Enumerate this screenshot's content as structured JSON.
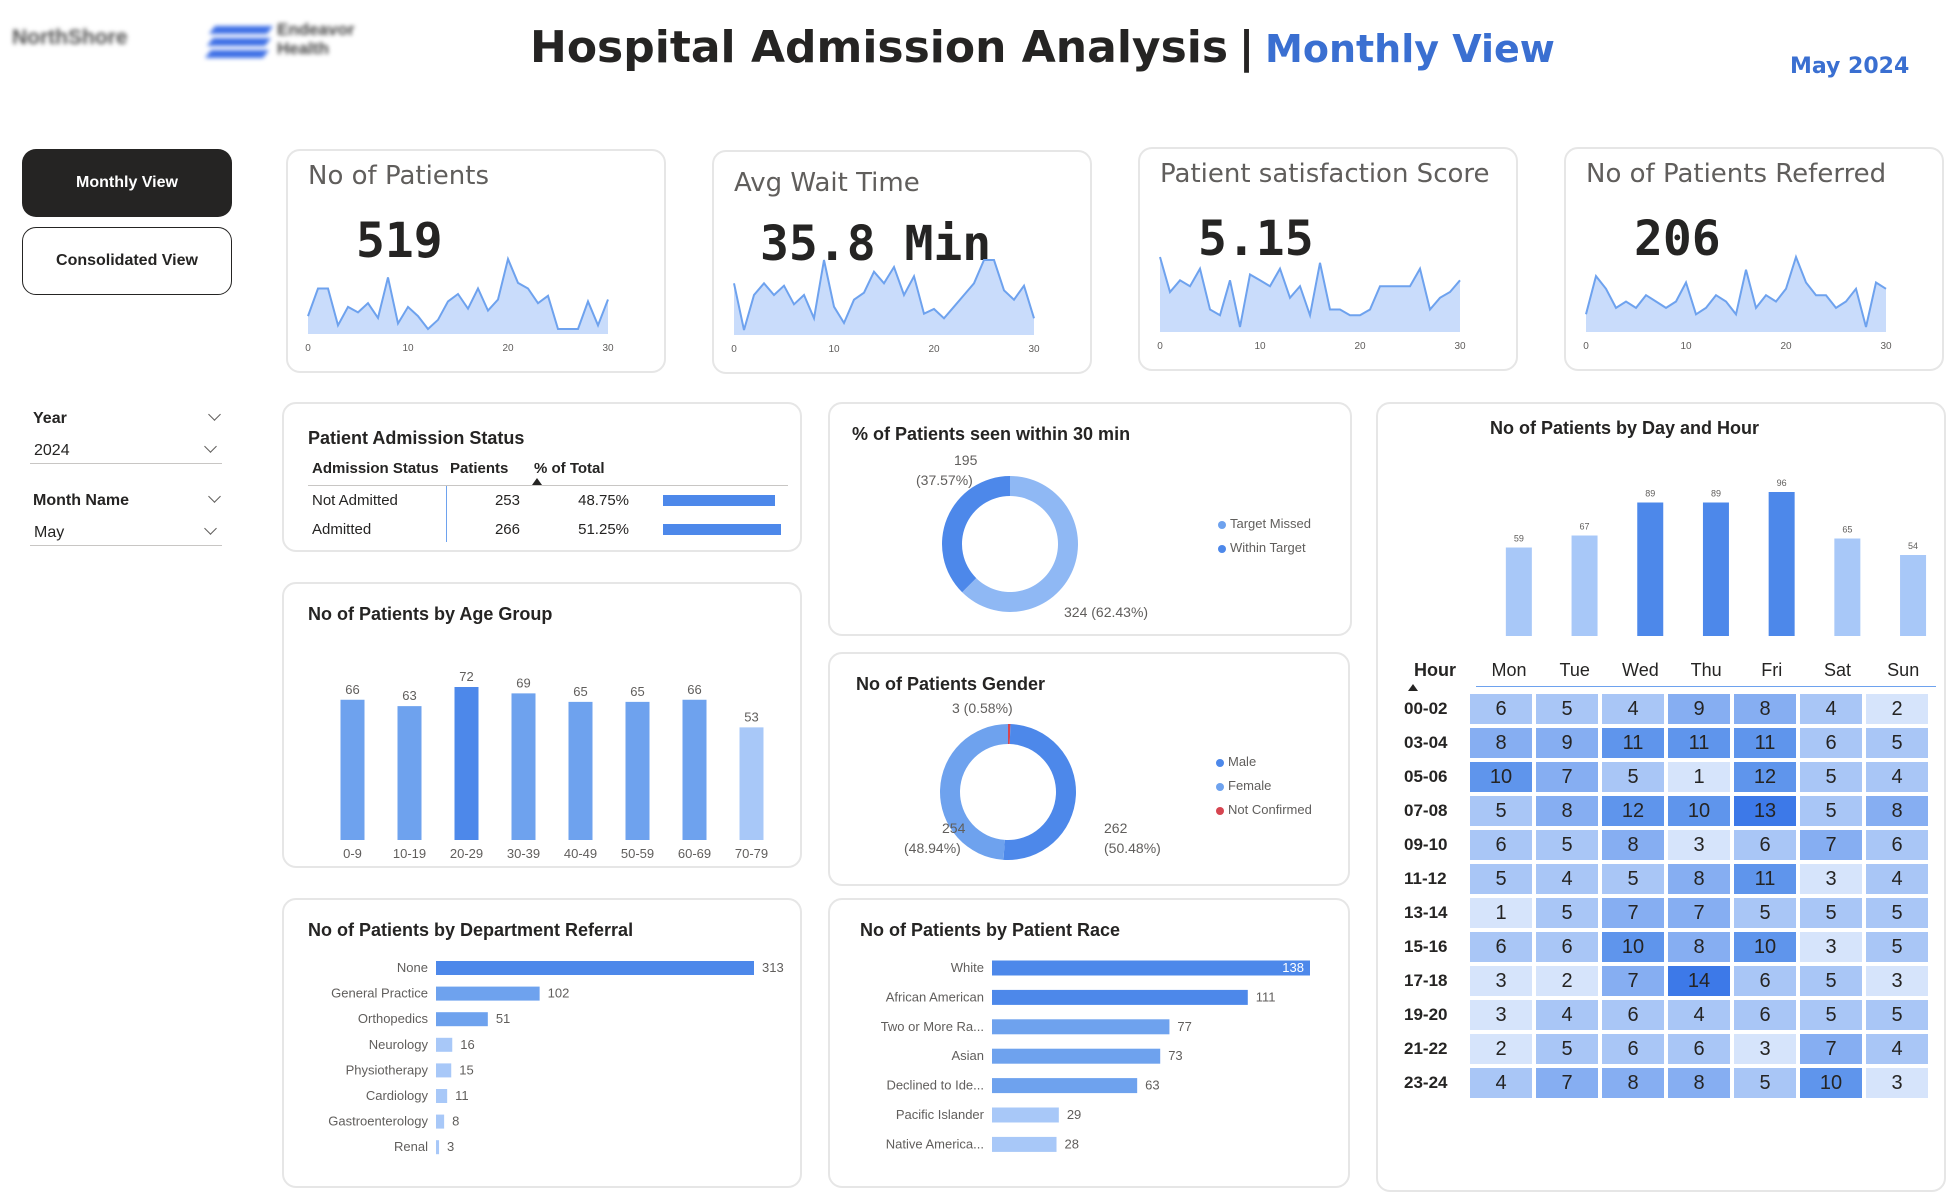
{
  "header": {
    "title": "Hospital Admission Analysis",
    "separator": "|",
    "view_label": "Monthly View",
    "date_label": "May 2024",
    "logo1_text": "NorthShore",
    "logo2_line1": "Endeavor",
    "logo2_line2": "Health"
  },
  "nav": {
    "monthly_label": "Monthly View",
    "consolidated_label": "Consolidated View"
  },
  "filters": {
    "year_label": "Year",
    "year_value": "2024",
    "month_label": "Month Name",
    "month_value": "May"
  },
  "colors": {
    "accent_blue": "#3a6fd1",
    "bar_dark": "#4d88ea",
    "bar_mid": "#6ea2ee",
    "bar_light": "#a8c8f8",
    "sparkline_fill": "#c9dcfb",
    "sparkline_line": "#6ea2ee",
    "not_confirmed": "#d64550"
  },
  "kpis": [
    {
      "title": "No of Patients",
      "value": "519",
      "ticks": [
        "0",
        "10",
        "20",
        "30"
      ],
      "series": [
        15,
        30,
        30,
        10,
        20,
        17,
        22,
        14,
        36,
        11,
        20,
        15,
        8,
        13,
        23,
        27,
        19,
        30,
        18,
        24,
        46,
        33,
        30,
        22,
        26,
        8,
        8,
        8,
        23,
        10,
        24
      ]
    },
    {
      "title": "Avg Wait Time",
      "value": "35.8 Min",
      "ticks": [
        "0",
        "10",
        "20",
        "30"
      ],
      "series": [
        45,
        25,
        40,
        45,
        40,
        44,
        36,
        40,
        30,
        55,
        35,
        28,
        38,
        41,
        50,
        45,
        52,
        40,
        48,
        32,
        34,
        30,
        35,
        40,
        45,
        55,
        55,
        42,
        38,
        44,
        30
      ]
    },
    {
      "title": "Patient satisfaction Score",
      "value": "5.15",
      "ticks": [
        "0",
        "10",
        "20",
        "30"
      ],
      "series": [
        6.2,
        5.6,
        5.8,
        5.7,
        6.0,
        5.3,
        5.2,
        5.8,
        5.0,
        5.9,
        5.8,
        5.7,
        6.0,
        5.5,
        5.7,
        5.2,
        6.1,
        5.3,
        5.3,
        5.2,
        5.2,
        5.3,
        5.7,
        5.7,
        5.7,
        5.7,
        6.0,
        5.3,
        5.5,
        5.6,
        5.8
      ]
    },
    {
      "title": "No of Patients Referred",
      "value": "206",
      "ticks": [
        "0",
        "10",
        "20",
        "30"
      ],
      "series": [
        4,
        10,
        8,
        5,
        6,
        5,
        7,
        6,
        5,
        6,
        9,
        4,
        5,
        7,
        6,
        4,
        11,
        5,
        7,
        6,
        8,
        13,
        9,
        7,
        7,
        5,
        6,
        8,
        2,
        9,
        8
      ]
    }
  ],
  "admission_status": {
    "title": "Patient Admission Status",
    "columns": [
      "Admission Status",
      "Patients",
      "% of Total"
    ],
    "rows": [
      {
        "status": "Not Admitted",
        "patients": "253",
        "pct": "48.75%",
        "fraction": 0.4875
      },
      {
        "status": "Admitted",
        "patients": "266",
        "pct": "51.25%",
        "fraction": 0.5125
      }
    ]
  },
  "seen_30": {
    "title": "% of Patients seen within 30 min",
    "legend": [
      "Target Missed",
      "Within Target"
    ],
    "label_within_value": "195",
    "label_within_pct": "(37.57%)",
    "label_missed": "324 (62.43%)"
  },
  "gender": {
    "title": "No of Patients Gender",
    "legend": [
      "Male",
      "Female",
      "Not Confirmed"
    ],
    "label_nc": "3 (0.58%)",
    "label_female_value": "254",
    "label_female_pct": "(48.94%)",
    "label_male_value": "262",
    "label_male_pct": "(50.48%)"
  },
  "age_group": {
    "title": "No of Patients by Age Group"
  },
  "department": {
    "title": "No of Patients by Department Referral"
  },
  "race": {
    "title": "No of Patients by Patient Race"
  },
  "day_hour": {
    "title": "No of Patients by Day and Hour",
    "hour_header": "Hour",
    "days": [
      "Mon",
      "Tue",
      "Wed",
      "Thu",
      "Fri",
      "Sat",
      "Sun"
    ],
    "hours": [
      "00-02",
      "03-04",
      "05-06",
      "07-08",
      "09-10",
      "11-12",
      "13-14",
      "15-16",
      "17-18",
      "19-20",
      "21-22",
      "23-24"
    ],
    "matrix": [
      [
        6,
        5,
        4,
        9,
        8,
        4,
        2
      ],
      [
        8,
        9,
        11,
        11,
        11,
        6,
        5
      ],
      [
        10,
        7,
        5,
        1,
        12,
        5,
        4
      ],
      [
        5,
        8,
        12,
        10,
        13,
        5,
        8
      ],
      [
        6,
        5,
        8,
        3,
        6,
        7,
        6
      ],
      [
        5,
        4,
        5,
        8,
        11,
        3,
        4
      ],
      [
        1,
        5,
        7,
        7,
        5,
        5,
        5
      ],
      [
        6,
        6,
        10,
        8,
        10,
        3,
        5
      ],
      [
        3,
        2,
        7,
        14,
        6,
        5,
        3
      ],
      [
        3,
        4,
        6,
        4,
        6,
        5,
        5
      ],
      [
        2,
        5,
        6,
        6,
        3,
        7,
        4
      ],
      [
        4,
        7,
        8,
        8,
        5,
        10,
        3
      ]
    ]
  },
  "chart_data": [
    {
      "type": "pie",
      "title": "% of Patients seen within 30 min",
      "labels": [
        "Within Target",
        "Target Missed"
      ],
      "values": [
        195,
        324
      ],
      "percents": [
        37.57,
        62.43
      ],
      "legend": "right"
    },
    {
      "type": "pie",
      "title": "No of Patients Gender",
      "labels": [
        "Male",
        "Female",
        "Not Confirmed"
      ],
      "values": [
        262,
        254,
        3
      ],
      "percents": [
        50.48,
        48.94,
        0.58
      ],
      "legend": "right"
    },
    {
      "type": "bar",
      "title": "No of Patients by Age Group",
      "categories": [
        "0-9",
        "10-19",
        "20-29",
        "30-39",
        "40-49",
        "50-59",
        "60-69",
        "70-79"
      ],
      "values": [
        66,
        63,
        72,
        69,
        65,
        65,
        66,
        53
      ],
      "ylim": [
        0,
        80
      ]
    },
    {
      "type": "bar",
      "orientation": "horizontal",
      "title": "No of Patients by Department Referral",
      "categories": [
        "None",
        "General Practice",
        "Orthopedics",
        "Neurology",
        "Physiotherapy",
        "Cardiology",
        "Gastroenterology",
        "Renal"
      ],
      "values": [
        313,
        102,
        51,
        16,
        15,
        11,
        8,
        3
      ]
    },
    {
      "type": "bar",
      "orientation": "horizontal",
      "title": "No of Patients by Patient Race",
      "categories": [
        "White",
        "African American",
        "Two or More Ra...",
        "Asian",
        "Declined to Ide...",
        "Pacific Islander",
        "Native America..."
      ],
      "values": [
        138,
        111,
        77,
        73,
        63,
        29,
        28
      ]
    },
    {
      "type": "bar",
      "title": "No of Patients by Day and Hour",
      "categories": [
        "Mon",
        "Tue",
        "Wed",
        "Thu",
        "Fri",
        "Sat",
        "Sun"
      ],
      "values": [
        59,
        67,
        89,
        89,
        96,
        65,
        54
      ]
    }
  ]
}
